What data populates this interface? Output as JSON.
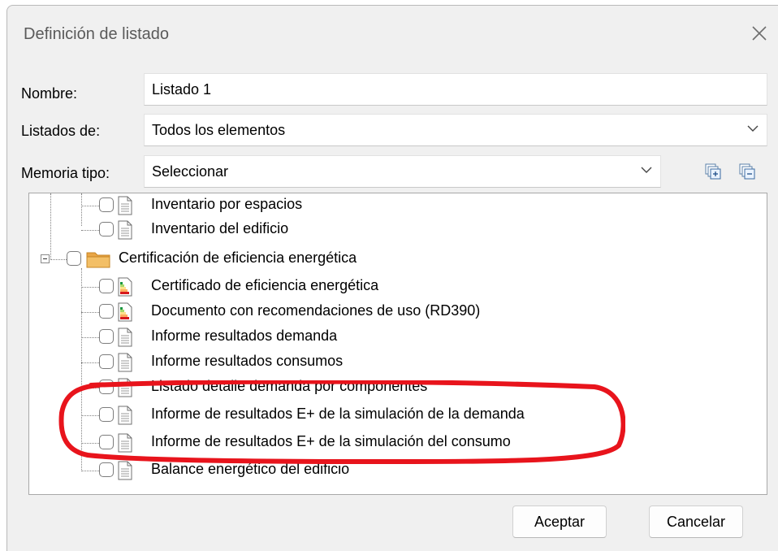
{
  "window": {
    "title": "Definición de listado",
    "close_icon": "close-icon"
  },
  "form": {
    "nombre_label": "Nombre:",
    "nombre_value": "Listado 1",
    "listados_label": "Listados de:",
    "listados_value": "Todos los elementos",
    "memoria_label": "Memoria tipo:",
    "memoria_value": "Seleccionar"
  },
  "toolbar": {
    "expand_all_icon": "expand-all-icon",
    "collapse_all_icon": "collapse-all-icon"
  },
  "tree": {
    "items": [
      {
        "label": "Inventario por espacios",
        "icon": "document-icon"
      },
      {
        "label": "Inventario del edificio",
        "icon": "document-icon"
      },
      {
        "label": "Certificación de eficiencia energética",
        "icon": "folder-icon"
      },
      {
        "label": "Certificado de eficiencia energética",
        "icon": "energy-label-icon"
      },
      {
        "label": "Documento con recomendaciones de uso (RD390)",
        "icon": "energy-label-icon"
      },
      {
        "label": "Informe resultados demanda",
        "icon": "document-icon"
      },
      {
        "label": "Informe resultados consumos",
        "icon": "document-icon"
      },
      {
        "label": "Listado detalle demanda por componentes",
        "icon": "document-icon"
      },
      {
        "label": "Informe de resultados E+ de la simulación de la demanda",
        "icon": "document-icon"
      },
      {
        "label": "Informe de resultados E+ de la simulación del consumo",
        "icon": "document-icon"
      },
      {
        "label": "Balance energético del edificio",
        "icon": "document-icon"
      }
    ]
  },
  "buttons": {
    "accept": "Aceptar",
    "cancel": "Cancelar"
  },
  "colors": {
    "highlight": "#e8141c",
    "folder": "#f0b84e"
  }
}
